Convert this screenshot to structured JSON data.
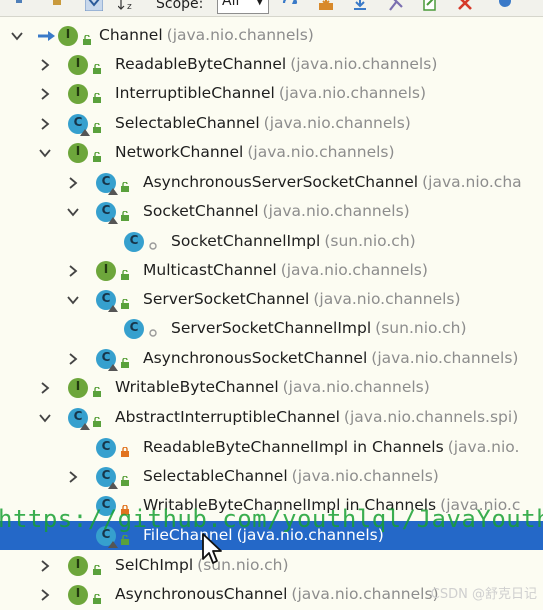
{
  "toolbar": {
    "scope_label": "Scope:",
    "scope_value": "All"
  },
  "colors": {
    "background": "#fcfcf2",
    "selection": "#2468c8",
    "interface_icon": "#6da63b",
    "class_icon": "#36a0ce",
    "package_text": "#8d8d8d",
    "watermark": "#18a032"
  },
  "tree": [
    {
      "name": "Channel",
      "pkg": "(java.nio.channels)",
      "kind": "interface",
      "level": 0,
      "expand": "expanded",
      "vis": "public",
      "root": true
    },
    {
      "name": "ReadableByteChannel",
      "pkg": "(java.nio.channels)",
      "kind": "interface",
      "level": 1,
      "expand": "collapsed",
      "vis": "public"
    },
    {
      "name": "InterruptibleChannel",
      "pkg": "(java.nio.channels)",
      "kind": "interface",
      "level": 1,
      "expand": "collapsed",
      "vis": "public"
    },
    {
      "name": "SelectableChannel",
      "pkg": "(java.nio.channels)",
      "kind": "abstract",
      "level": 1,
      "expand": "collapsed",
      "vis": "public"
    },
    {
      "name": "NetworkChannel",
      "pkg": "(java.nio.channels)",
      "kind": "interface",
      "level": 1,
      "expand": "expanded",
      "vis": "public"
    },
    {
      "name": "AsynchronousServerSocketChannel",
      "pkg": "(java.nio.cha",
      "kind": "abstract",
      "level": 2,
      "expand": "collapsed",
      "vis": "public"
    },
    {
      "name": "SocketChannel",
      "pkg": "(java.nio.channels)",
      "kind": "abstract",
      "level": 2,
      "expand": "expanded",
      "vis": "public"
    },
    {
      "name": "SocketChannelImpl",
      "pkg": "(sun.nio.ch)",
      "kind": "class",
      "level": 3,
      "expand": "none",
      "vis": "package"
    },
    {
      "name": "MulticastChannel",
      "pkg": "(java.nio.channels)",
      "kind": "interface",
      "level": 2,
      "expand": "collapsed",
      "vis": "public"
    },
    {
      "name": "ServerSocketChannel",
      "pkg": "(java.nio.channels)",
      "kind": "abstract",
      "level": 2,
      "expand": "expanded",
      "vis": "public"
    },
    {
      "name": "ServerSocketChannelImpl",
      "pkg": "(sun.nio.ch)",
      "kind": "class",
      "level": 3,
      "expand": "none",
      "vis": "package"
    },
    {
      "name": "AsynchronousSocketChannel",
      "pkg": "(java.nio.channels)",
      "kind": "abstract",
      "level": 2,
      "expand": "collapsed",
      "vis": "public"
    },
    {
      "name": "WritableByteChannel",
      "pkg": "(java.nio.channels)",
      "kind": "interface",
      "level": 1,
      "expand": "collapsed",
      "vis": "public"
    },
    {
      "name": "AbstractInterruptibleChannel",
      "pkg": "(java.nio.channels.spi)",
      "kind": "abstract",
      "level": 1,
      "expand": "expanded",
      "vis": "public"
    },
    {
      "name": "ReadableByteChannelImpl in Channels",
      "pkg": "(java.nio.",
      "kind": "class",
      "level": 2,
      "expand": "none",
      "vis": "private"
    },
    {
      "name": "SelectableChannel",
      "pkg": "(java.nio.channels)",
      "kind": "abstract",
      "level": 2,
      "expand": "collapsed",
      "vis": "public"
    },
    {
      "name": "WritableByteChannelImpl in Channels",
      "pkg": "(java.nio.c",
      "kind": "class",
      "level": 2,
      "expand": "none",
      "vis": "private"
    },
    {
      "name": "FileChannel",
      "pkg": "(java.nio.channels)",
      "kind": "abstract",
      "level": 2,
      "expand": "none",
      "vis": "public",
      "selected": true
    },
    {
      "name": "SelChImpl",
      "pkg": "(sun.nio.ch)",
      "kind": "interface",
      "level": 1,
      "expand": "collapsed",
      "vis": "public"
    },
    {
      "name": "AsynchronousChannel",
      "pkg": "(java.nio.channels)",
      "kind": "interface",
      "level": 1,
      "expand": "collapsed",
      "vis": "public"
    }
  ],
  "watermark_text": "https://github.com/youthlql/JavaYouth",
  "csdn_watermark": "CSDN @舒克日记"
}
